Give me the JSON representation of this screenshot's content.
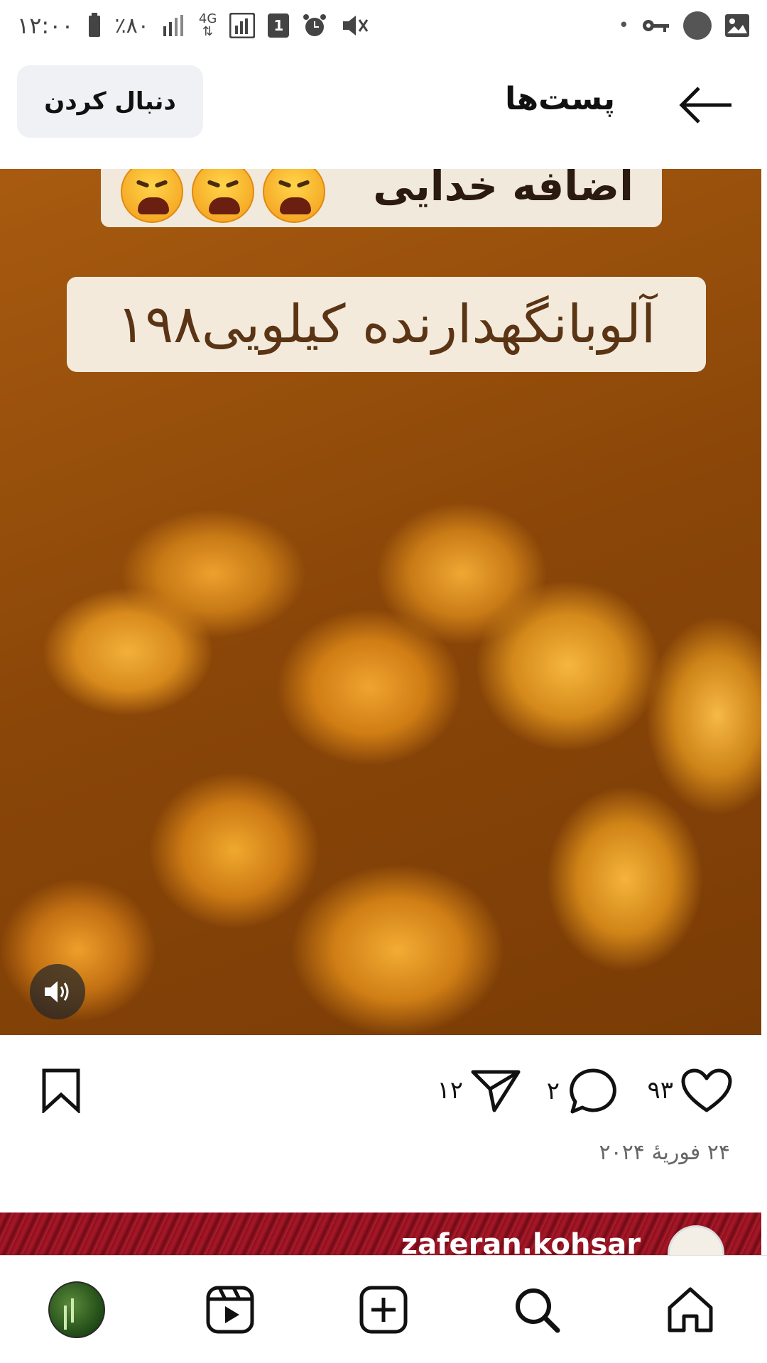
{
  "status_bar": {
    "time": "۱۲:۰۰",
    "battery_percent": "٪۸۰",
    "network": "4G",
    "sim_slot": "1",
    "dot": "•"
  },
  "header": {
    "title": "پست‌ها",
    "follow_label": "دنبال کردن"
  },
  "post": {
    "overlay_top_text": "اضافه خدایی",
    "overlay_main_text": "آلوبانگهدارنده کیلویی۱۹۸",
    "likes": "۹۳",
    "comments": "۲",
    "shares": "۱۲",
    "date": "۲۴ فوريهٔ ۲۰۲۴"
  },
  "next_post": {
    "username": "zaferan.kohsar"
  },
  "colors": {
    "accent": "#111111",
    "follow_bg": "#eff1f4",
    "date_text": "#666666"
  },
  "icons": {
    "back": "arrow-left-icon",
    "sound": "speaker-icon",
    "like": "heart-icon",
    "comment": "comment-icon",
    "share": "send-icon",
    "save": "bookmark-icon",
    "nav": [
      "profile-avatar",
      "reels-icon",
      "add-icon",
      "search-icon",
      "home-icon"
    ]
  }
}
